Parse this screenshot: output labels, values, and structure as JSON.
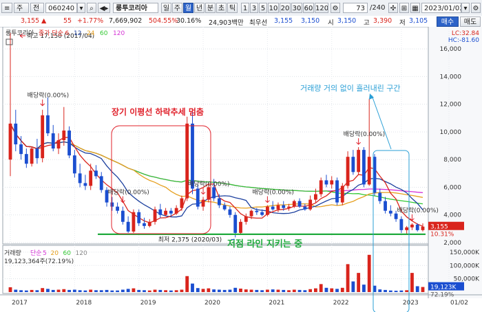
{
  "toolbar": {
    "menu_glyph": "≡",
    "market_label": "주",
    "type_label": "전",
    "code": "060240",
    "company": "룽투코리아",
    "period_tabs": [
      "일",
      "주",
      "월",
      "년",
      "분",
      "초",
      "틱"
    ],
    "active_period": "월",
    "minute_tabs": [
      "1",
      "3",
      "5",
      "10",
      "20",
      "30",
      "60",
      "120"
    ],
    "page_count": "73",
    "page_total": "/240",
    "date": "2023/01/02",
    "buy_label": "매수",
    "sell_label": "매도"
  },
  "quote": {
    "price": "3,155",
    "change": "55",
    "change_pct": "+1.77%",
    "volume": "7,669,902",
    "volume_ratio": "504.55%",
    "turnover": "30.16%",
    "amount": "24,903백만",
    "preferred_label": "최우선",
    "bid": "3,155",
    "ask": "3,150",
    "open_label": "시",
    "open": "3,150",
    "high_label": "고",
    "high": "3,390",
    "low_label": "저",
    "low": "3,105"
  },
  "colors": {
    "up": "#d9241c",
    "down": "#1b4ed0",
    "ma6": "#d9241c",
    "ma12": "#1b3f9e",
    "ma24": "#e6a020",
    "ma60": "#33c833",
    "ma120": "#d633d6",
    "support": "#1faa3c",
    "annot_red": "#e0202a",
    "annot_blue": "#2a9fd6"
  },
  "chart_data": [
    {
      "type": "candlestick",
      "title": "룽투코리아",
      "legend": [
        {
          "label": "종가 단순",
          "color": "#d9241c"
        },
        {
          "label": "6",
          "color": "#d9241c"
        },
        {
          "label": "12",
          "color": "#1b3f9e"
        },
        {
          "label": "24",
          "color": "#e6a020"
        },
        {
          "label": "60",
          "color": "#33c833"
        },
        {
          "label": "120",
          "color": "#d633d6"
        }
      ],
      "x_ticks": [
        "2017",
        "2018",
        "2019",
        "2020",
        "2021",
        "2022",
        "2023",
        "01/02"
      ],
      "y_ticks": [
        "16,000",
        "14,000",
        "12,000",
        "10,000",
        "8,000",
        "6,000",
        "4,000",
        "2,000"
      ],
      "ylim": [
        1900,
        17200
      ],
      "top_right_labels": [
        "LC:32.84",
        "HC:-81.60"
      ],
      "last_price_tag": "3,155",
      "last_pct_tag": "10.31%",
      "annotations": {
        "high": "최고 17,150 (2017/04)",
        "low": "최저 2,375 (2020/03)",
        "dividend_label": "배당락(0.00%)",
        "box_text": "장기 이평선 하락추세 멈춤",
        "support_text": "저점 라인 지키는 중",
        "volume_text": "거래량 거의 없이 흘러내린 구간"
      },
      "support_level": 2600,
      "ohlc": [
        [
          8000,
          17150,
          6800,
          10600
        ],
        [
          10600,
          11600,
          8600,
          9100
        ],
        [
          9100,
          9700,
          8000,
          8400
        ],
        [
          8400,
          8800,
          7400,
          7700
        ],
        [
          7700,
          8900,
          7500,
          8800
        ],
        [
          8800,
          9500,
          7700,
          8100
        ],
        [
          8100,
          11600,
          7800,
          11200
        ],
        [
          11200,
          12500,
          9700,
          9900
        ],
        [
          9900,
          10500,
          8600,
          8800
        ],
        [
          8800,
          9900,
          8400,
          9400
        ],
        [
          9400,
          11800,
          9000,
          10100
        ],
        [
          10100,
          10400,
          8100,
          8300
        ],
        [
          8300,
          8700,
          6700,
          7000
        ],
        [
          7000,
          7700,
          6000,
          6300
        ],
        [
          6300,
          6900,
          5800,
          6100
        ],
        [
          6100,
          7700,
          5800,
          7200
        ],
        [
          7200,
          7600,
          6600,
          6800
        ],
        [
          6800,
          7100,
          5600,
          5800
        ],
        [
          5800,
          6000,
          4600,
          4900
        ],
        [
          4900,
          5300,
          4300,
          4600
        ],
        [
          4600,
          4900,
          4100,
          4300
        ],
        [
          4300,
          4600,
          3300,
          3500
        ],
        [
          3500,
          3900,
          2700,
          2800
        ],
        [
          2800,
          4400,
          2700,
          4200
        ],
        [
          4200,
          4400,
          3200,
          3400
        ],
        [
          3400,
          3800,
          3000,
          3200
        ],
        [
          3200,
          3700,
          3100,
          3500
        ],
        [
          3500,
          4600,
          3300,
          4400
        ],
        [
          4400,
          4800,
          3800,
          4000
        ],
        [
          4000,
          4500,
          3900,
          4300
        ],
        [
          4300,
          4500,
          3900,
          4100
        ],
        [
          4100,
          4700,
          4000,
          4500
        ],
        [
          4500,
          5400,
          4300,
          5200
        ],
        [
          5200,
          11100,
          5000,
          10600
        ],
        [
          10600,
          11500,
          5500,
          5900
        ],
        [
          5900,
          6200,
          4400,
          4600
        ],
        [
          4600,
          5300,
          4300,
          5100
        ],
        [
          5100,
          6200,
          4900,
          6000
        ],
        [
          6000,
          6600,
          5000,
          5200
        ],
        [
          5200,
          5500,
          4500,
          4700
        ],
        [
          4700,
          4900,
          4300,
          4400
        ],
        [
          4400,
          4600,
          3800,
          4000
        ],
        [
          4000,
          4200,
          2375,
          2700
        ],
        [
          2700,
          3700,
          2600,
          3500
        ],
        [
          3500,
          4100,
          3300,
          3900
        ],
        [
          3900,
          4400,
          3700,
          4300
        ],
        [
          4300,
          4500,
          4000,
          4200
        ],
        [
          4200,
          4400,
          3900,
          4000
        ],
        [
          4000,
          4700,
          3900,
          4600
        ],
        [
          4600,
          5000,
          4300,
          4400
        ],
        [
          4400,
          4900,
          4200,
          4700
        ],
        [
          4700,
          5000,
          4300,
          4500
        ],
        [
          4500,
          4800,
          4300,
          4600
        ],
        [
          4600,
          5100,
          4500,
          5000
        ],
        [
          5000,
          5200,
          4500,
          4600
        ],
        [
          4600,
          4800,
          4300,
          4400
        ],
        [
          4400,
          5400,
          4300,
          5100
        ],
        [
          5100,
          5900,
          4900,
          5500
        ],
        [
          5500,
          6700,
          5300,
          6500
        ],
        [
          6500,
          6900,
          6000,
          6200
        ],
        [
          6200,
          6800,
          5900,
          6500
        ],
        [
          6500,
          6700,
          4700,
          4900
        ],
        [
          4900,
          6300,
          4700,
          6100
        ],
        [
          6100,
          8600,
          5900,
          8200
        ],
        [
          8200,
          8700,
          6900,
          7100
        ],
        [
          7100,
          8900,
          6900,
          8700
        ],
        [
          8700,
          8900,
          6000,
          6200
        ],
        [
          6200,
          12400,
          6100,
          8200
        ],
        [
          8200,
          8400,
          5400,
          5600
        ],
        [
          5600,
          5900,
          4800,
          5000
        ],
        [
          5000,
          5300,
          4100,
          4300
        ],
        [
          4300,
          4700,
          3900,
          4100
        ],
        [
          4100,
          4300,
          3500,
          3700
        ],
        [
          3700,
          3900,
          2700,
          2900
        ],
        [
          2900,
          3200,
          2600,
          3100
        ],
        [
          3100,
          3400,
          2900,
          3300
        ],
        [
          3300,
          3390,
          2800,
          2900
        ],
        [
          2900,
          3390,
          2800,
          3155
        ]
      ],
      "ma_keys": [
        "ma6",
        "ma12",
        "ma24",
        "ma60",
        "ma120"
      ]
    },
    {
      "type": "bar",
      "title": "거래량",
      "legend": [
        {
          "label": "단순",
          "color": "#d633d6"
        },
        {
          "label": "5",
          "color": "#d633d6"
        },
        {
          "label": "20",
          "color": "#e6a020"
        },
        {
          "label": "60",
          "color": "#33c833"
        },
        {
          "label": "120",
          "color": "#888888"
        }
      ],
      "info": "19,123,364주(72.19%)",
      "y_ticks": [
        "150,000K",
        "100,000K",
        "50,000K"
      ],
      "ylim": [
        0,
        155000
      ],
      "last_volume_tag": "19,123K",
      "last_volume_pct": "72.19%",
      "values": [
        18000,
        9000,
        7000,
        6000,
        8000,
        7000,
        15000,
        12000,
        8000,
        9000,
        11000,
        8000,
        9000,
        7000,
        6000,
        9000,
        7000,
        7000,
        8000,
        6000,
        6000,
        9000,
        12000,
        14000,
        8000,
        7000,
        6000,
        9000,
        8000,
        7000,
        6000,
        7000,
        9000,
        60000,
        32000,
        15000,
        12000,
        14000,
        10000,
        9000,
        8000,
        9000,
        16000,
        13000,
        10000,
        9000,
        8000,
        7000,
        9000,
        10000,
        9000,
        8000,
        7000,
        9000,
        8000,
        7000,
        11000,
        14000,
        30000,
        16000,
        14000,
        12000,
        16000,
        105000,
        40000,
        72000,
        28000,
        140000,
        24000,
        10000,
        8000,
        6000,
        5000,
        6000,
        7000,
        72000,
        22000,
        19123
      ]
    }
  ]
}
